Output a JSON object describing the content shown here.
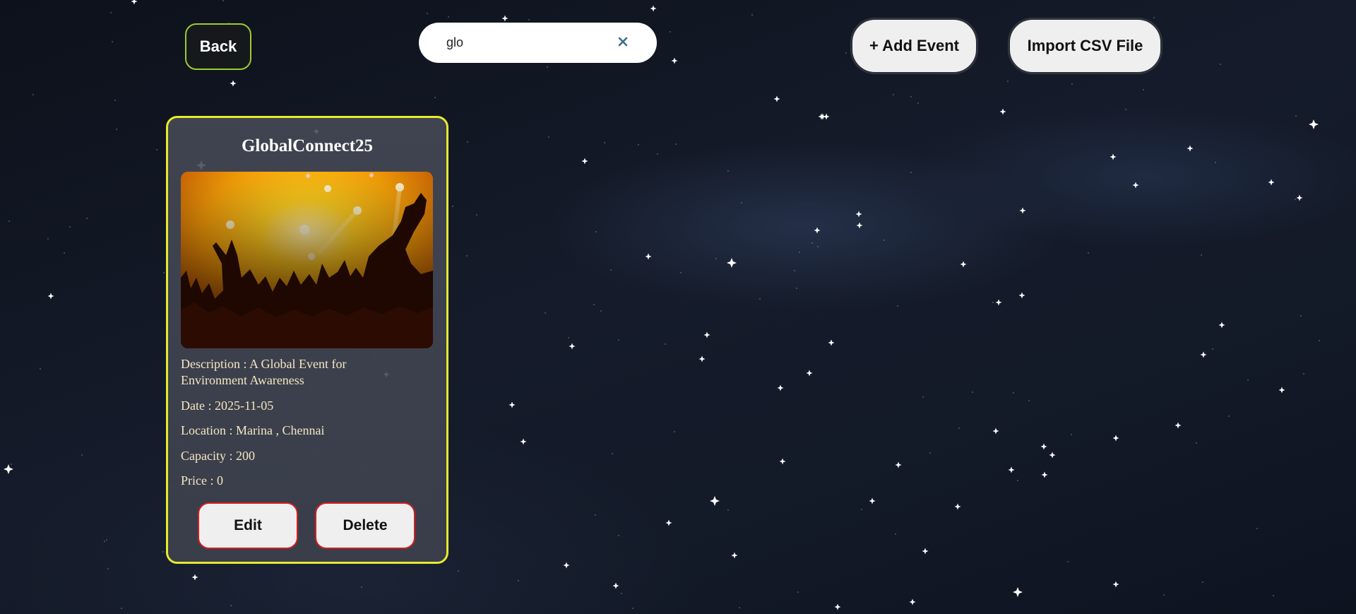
{
  "header": {
    "back_label": "Back",
    "search": {
      "value": "glo",
      "clear_glyph": "×"
    },
    "add_event_label": "+ Add Event",
    "import_csv_label": "Import CSV File"
  },
  "event_card": {
    "title": "GlobalConnect25",
    "image_icon": "concert-crowd-image",
    "fields": {
      "description": "Description : A Global Event for Environment Awareness",
      "date": "Date : 2025-11-05",
      "location": "Location : Marina , Chennai",
      "capacity": "Capacity : 200",
      "price": "Price : 0"
    },
    "edit_label": "Edit",
    "delete_label": "Delete"
  },
  "colors": {
    "card_border": "#e6ea2c",
    "back_border": "#9ccc2f",
    "card_button_border": "#d01f1f",
    "field_text": "#f5e6c2"
  }
}
